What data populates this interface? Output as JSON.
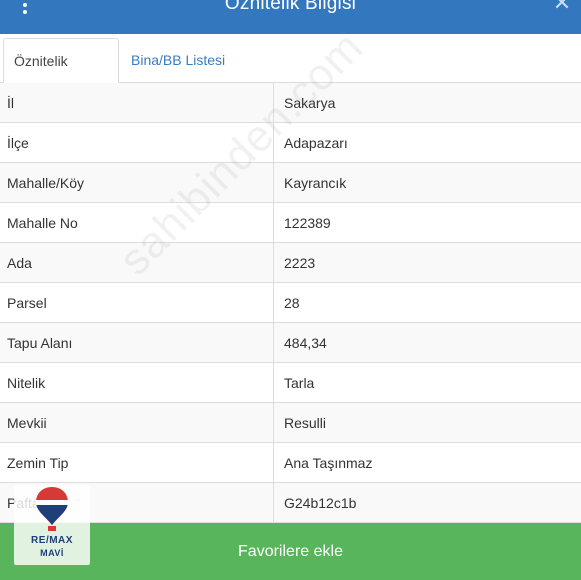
{
  "header": {
    "title": "Öznitelik Bilgisi"
  },
  "tabs": [
    {
      "label": "Öznitelik Bilgisi",
      "active": true
    },
    {
      "label": "Bina/BB Listesi",
      "active": false
    }
  ],
  "rows": [
    {
      "label": "İl",
      "value": "Sakarya"
    },
    {
      "label": "İlçe",
      "value": "Adapazarı"
    },
    {
      "label": "Mahalle/Köy",
      "value": "Kayrancık"
    },
    {
      "label": "Mahalle No",
      "value": "122389"
    },
    {
      "label": "Ada",
      "value": "2223"
    },
    {
      "label": "Parsel",
      "value": "28"
    },
    {
      "label": "Tapu Alanı",
      "value": "484,34"
    },
    {
      "label": "Nitelik",
      "value": "Tarla"
    },
    {
      "label": "Mevkii",
      "value": "Resulli"
    },
    {
      "label": "Zemin Tip",
      "value": "Ana Taşınmaz"
    },
    {
      "label": "Pafta",
      "value": "G24b12c1b"
    }
  ],
  "footer": {
    "button_label": "Favorilere ekle"
  },
  "watermark": {
    "text": "sahibinden.com"
  },
  "logo": {
    "brand": "RE/MAX",
    "sub": "MAVİ"
  },
  "colors": {
    "header": "#3378be",
    "tab_link": "#3a7cc0",
    "footer_button": "#58b55c"
  },
  "icons": {
    "menu": "vertical-ellipsis-icon",
    "close": "close-icon"
  }
}
